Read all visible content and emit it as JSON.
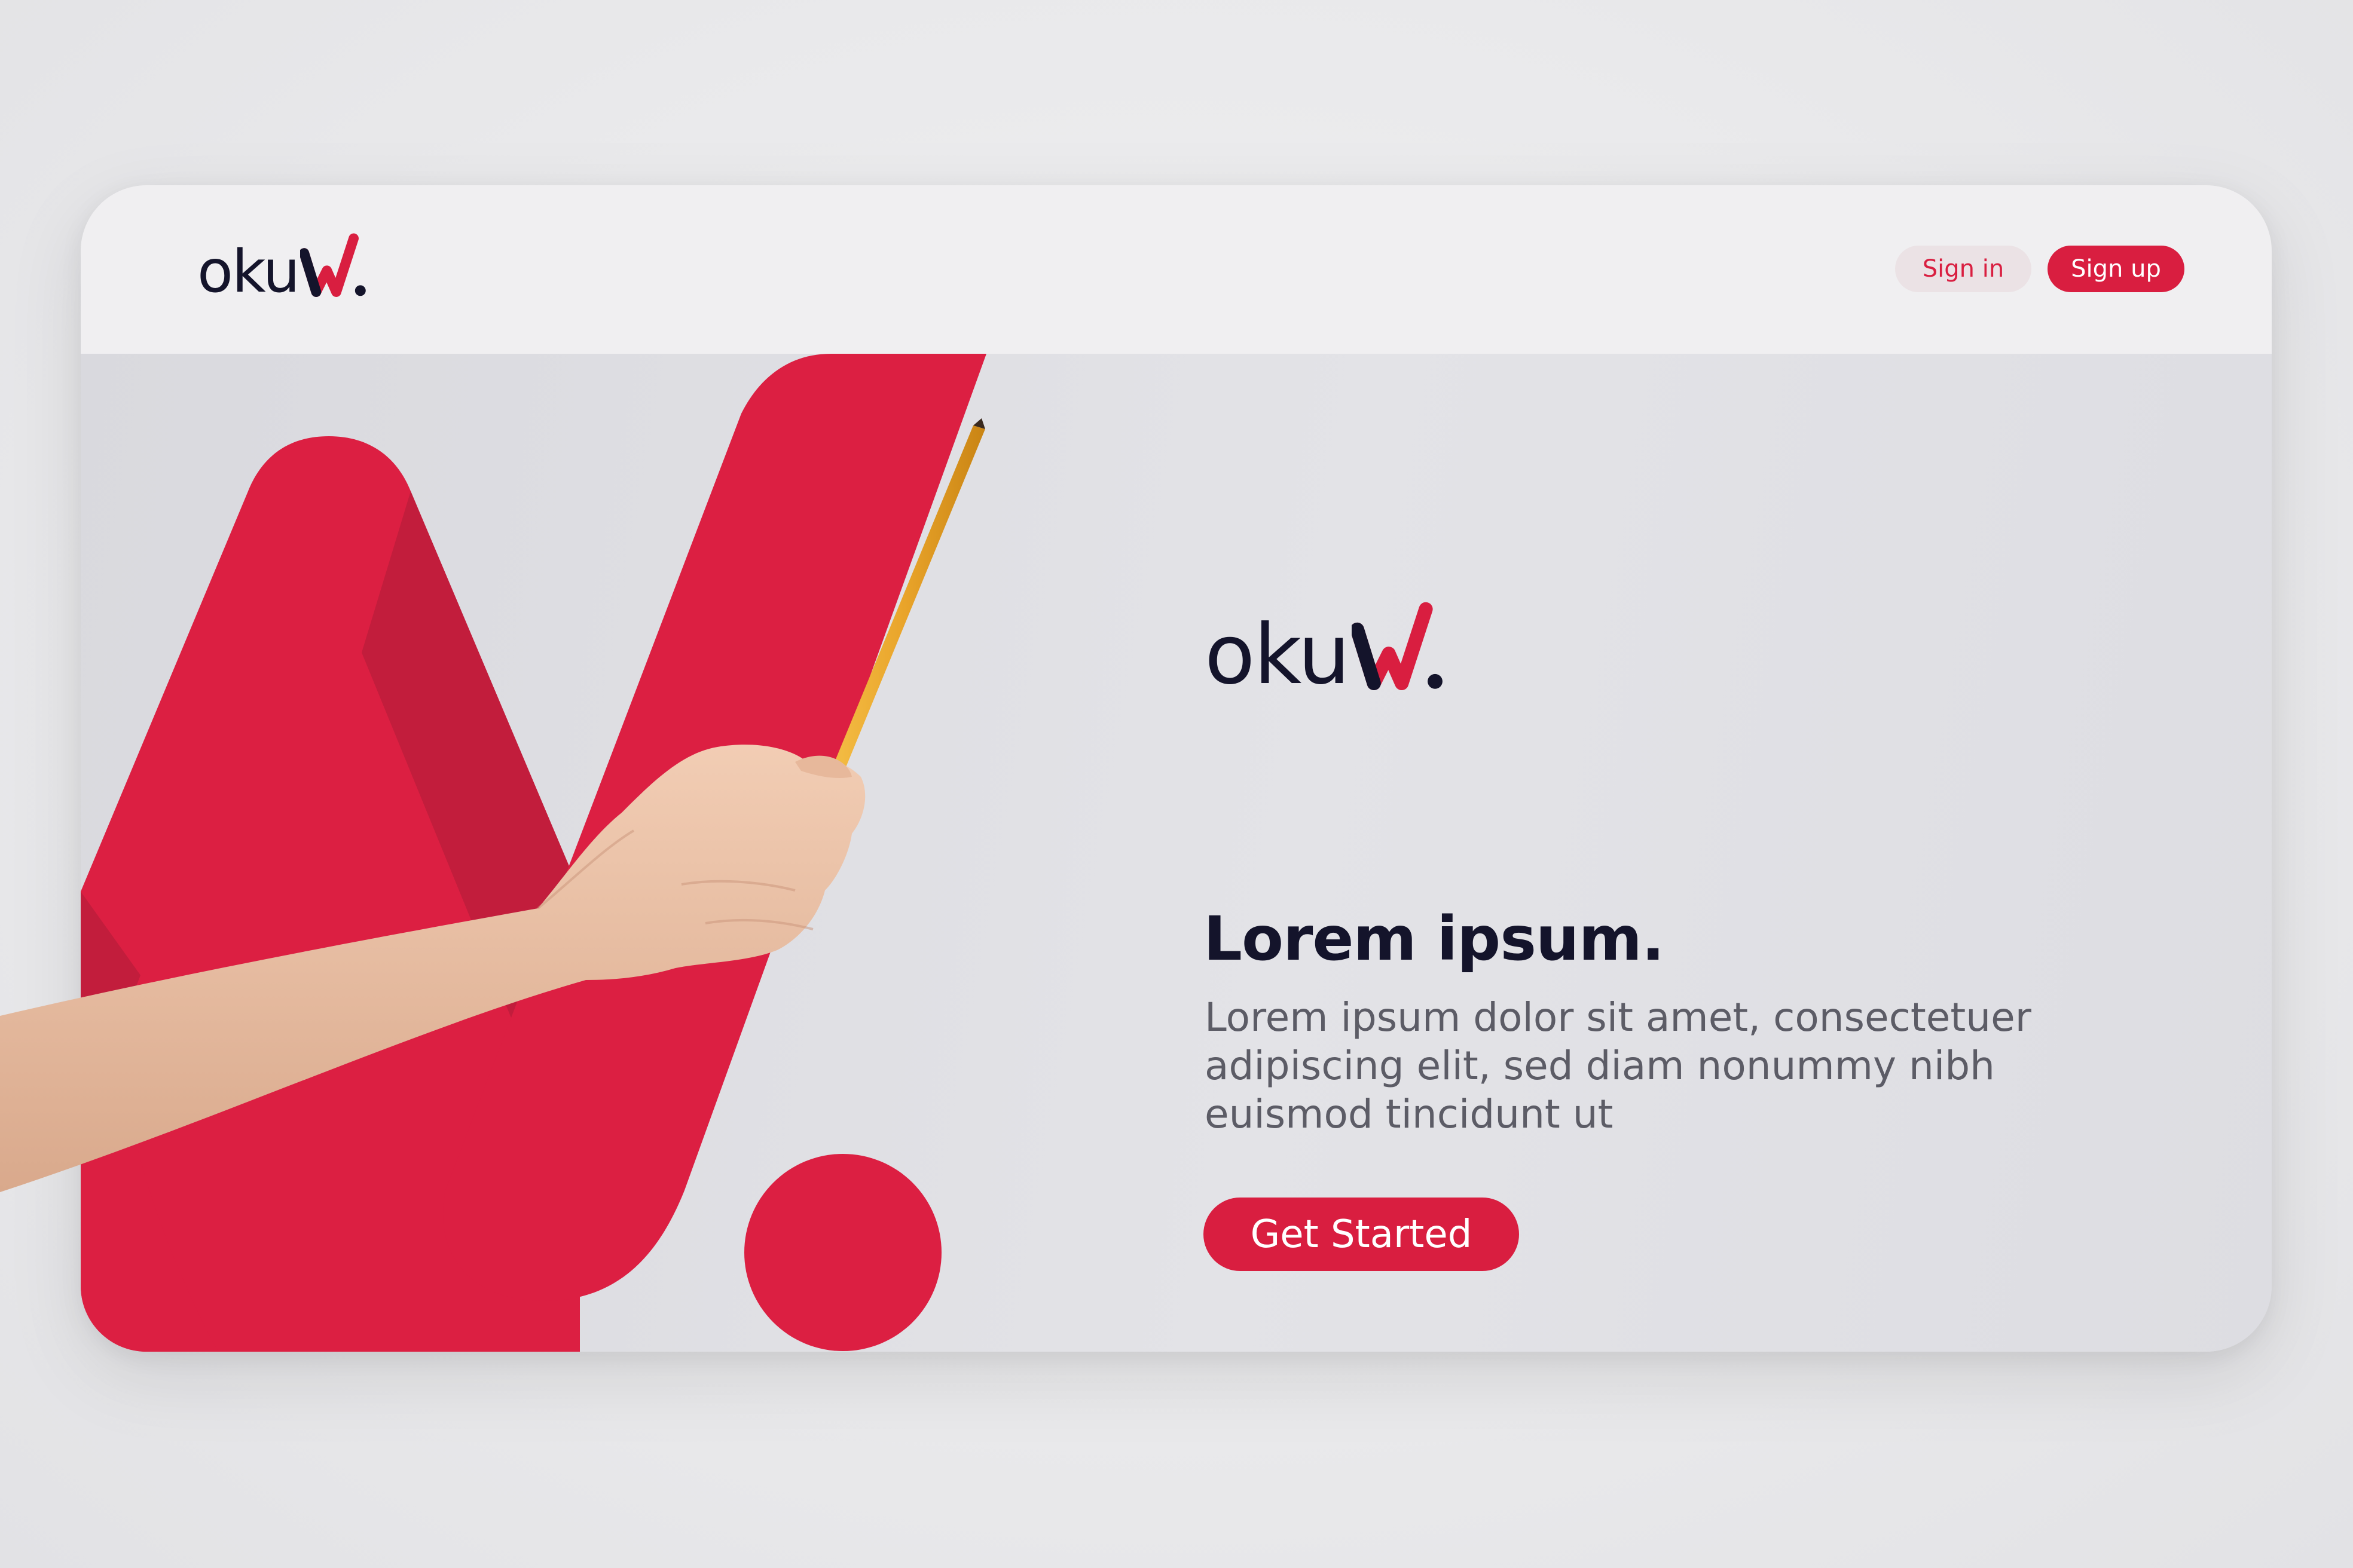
{
  "nav": {
    "logo_text": "oku",
    "sign_in_label": "Sign in",
    "sign_up_label": "Sign up"
  },
  "hero": {
    "logo_text": "oku",
    "heading": "Lorem ipsum.",
    "body": "Lorem ipsum dolor sit amet, consectetuer adipiscing elit, sed diam nonummy nibh euismod tincidunt ut",
    "cta_label": "Get Started"
  },
  "colors": {
    "brand_red": "#d91e40",
    "dark_text": "#14142b",
    "body_text": "#5c5c66",
    "nav_background": "#f0eff1",
    "hero_background": "#dedee2"
  },
  "icons": {
    "logo_mark": "red-w-with-dot",
    "hero_graphic": "large-red-w-logo-mark",
    "photo_overlay": "hand-holding-pencil"
  }
}
